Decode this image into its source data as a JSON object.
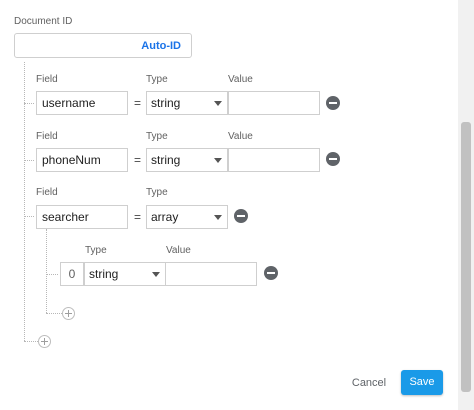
{
  "document_id": {
    "label": "Document ID",
    "value": "",
    "auto_id_label": "Auto-ID"
  },
  "column_labels": {
    "field": "Field",
    "type": "Type",
    "value": "Value"
  },
  "fields": [
    {
      "name": "username",
      "equals": "=",
      "type": "string",
      "value": ""
    },
    {
      "name": "phoneNum",
      "equals": "=",
      "type": "string",
      "value": ""
    },
    {
      "name": "searcher",
      "equals": "=",
      "type": "array",
      "items": [
        {
          "index": "0",
          "type": "string",
          "value": ""
        }
      ]
    }
  ],
  "actions": {
    "cancel": "Cancel",
    "save": "Save"
  },
  "colors": {
    "accent": "#1a9ae8",
    "link": "#1a73e8",
    "remove_icon": "#5f6368"
  }
}
